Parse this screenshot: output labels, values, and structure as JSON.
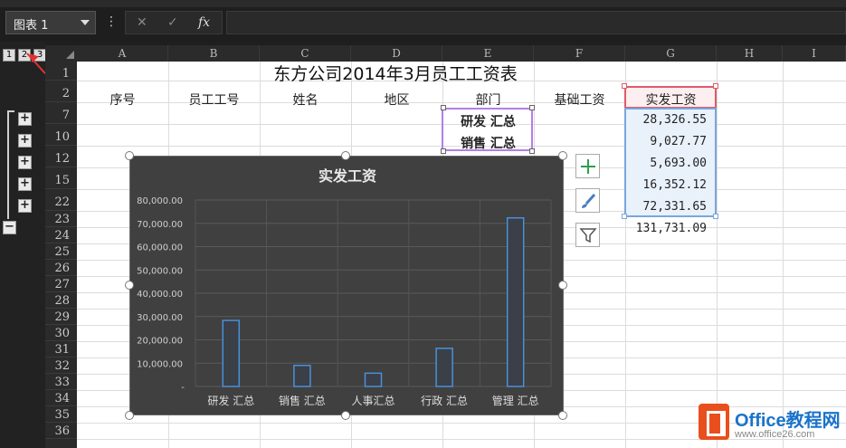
{
  "namebox": {
    "value": "图表 1"
  },
  "formula_bar": {
    "fx_label": "fx",
    "cancel": "✕",
    "confirm": "✓"
  },
  "outline": {
    "levels": [
      "1",
      "2",
      "3"
    ],
    "expand": "+",
    "collapse": "−"
  },
  "columns": [
    "A",
    "B",
    "C",
    "D",
    "E",
    "F",
    "G",
    "H",
    "I"
  ],
  "rows": [
    "1",
    "2",
    "7",
    "10",
    "12",
    "15",
    "22",
    "23",
    "24",
    "25",
    "26",
    "27",
    "28",
    "29",
    "30",
    "31",
    "32",
    "33",
    "34",
    "35",
    "36"
  ],
  "sheet": {
    "title": "东方公司2014年3月员工工资表",
    "headers": {
      "A": "序号",
      "B": "员工工号",
      "C": "姓名",
      "D": "地区",
      "E": "部门",
      "F": "基础工资",
      "G": "实发工资"
    },
    "dept_rows": [
      "研发 汇总",
      "销售 汇总"
    ],
    "salary_values": [
      "28,326.55",
      "9,027.77",
      "5,693.00",
      "16,352.12",
      "72,331.65",
      "131,731.09"
    ]
  },
  "chart_data": {
    "type": "bar",
    "title": "实发工资",
    "categories": [
      "研发 汇总",
      "销售 汇总",
      "人事汇总",
      "行政 汇总",
      "管理 汇总"
    ],
    "values": [
      28326.55,
      9027.77,
      5693.0,
      16352.12,
      72331.65
    ],
    "ylim": [
      0,
      80000
    ],
    "yticks": [
      "-",
      "10,000.00",
      "20,000.00",
      "30,000.00",
      "40,000.00",
      "50,000.00",
      "60,000.00",
      "70,000.00",
      "80,000.00"
    ],
    "grid": true,
    "colors": {
      "bar_edge": "#4a90d9",
      "bar_fill": "#3a3f48",
      "background": "#404040"
    }
  },
  "logo": {
    "name": "Office教程网",
    "url": "www.office26.com"
  }
}
